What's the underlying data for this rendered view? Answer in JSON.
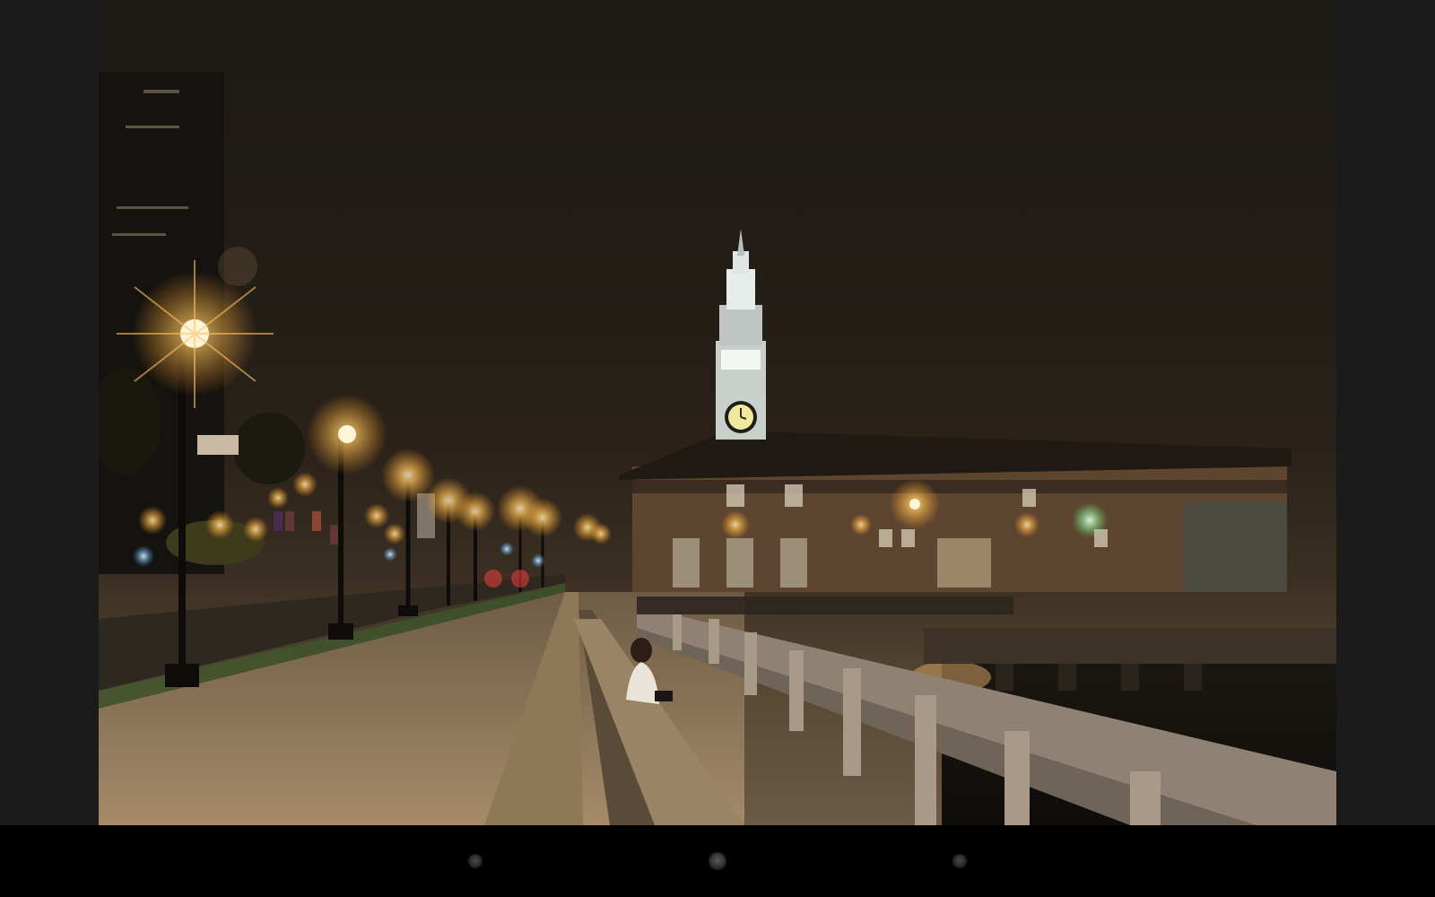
{
  "viewer": {
    "image_subject": "night-waterfront-photo"
  },
  "scene": {
    "sign_text": ""
  },
  "navbar": {
    "back_icon": "back-dot-icon",
    "home_icon": "home-dot-icon",
    "recents_icon": "recents-dot-icon"
  },
  "colors": {
    "sky": "#221c15",
    "lamp_glow": "#ffb347",
    "navbar": "#000000",
    "side_panel": "#1b1b1b"
  }
}
